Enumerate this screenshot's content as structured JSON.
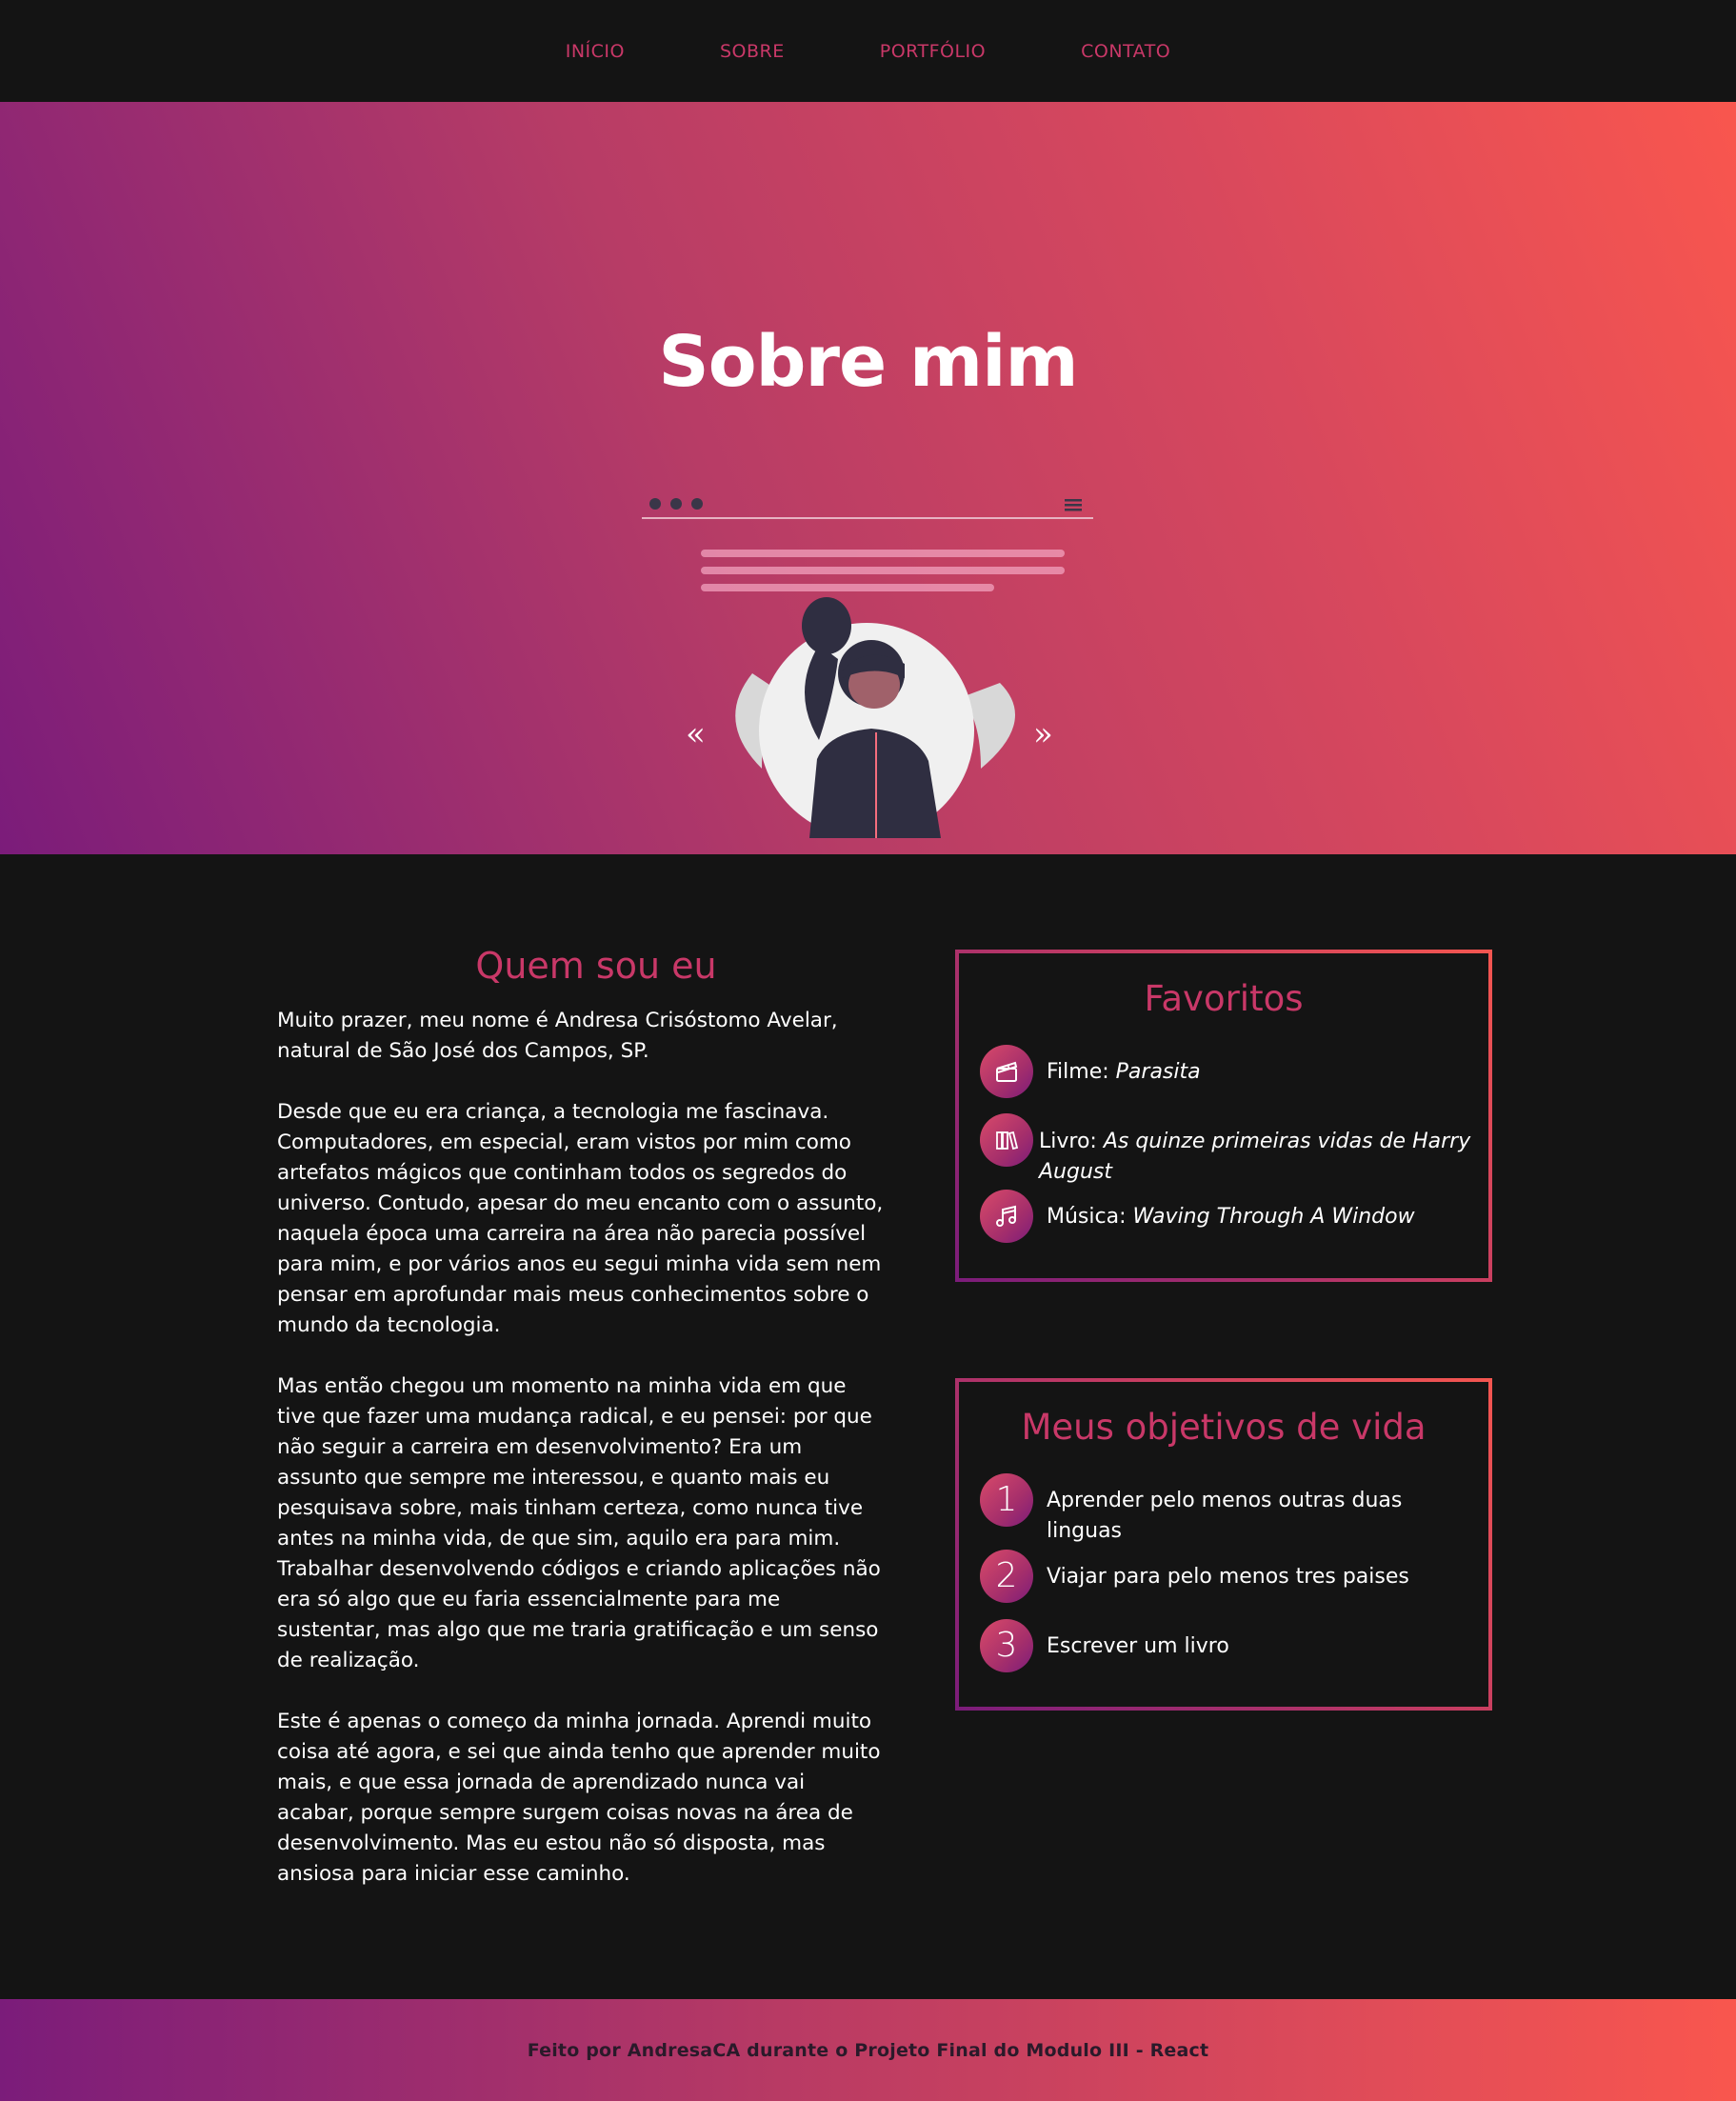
{
  "nav": {
    "items": [
      "INÍCIO",
      "SOBRE",
      "PORTFÓLIO",
      "CONTATO"
    ]
  },
  "hero": {
    "title": "Sobre mim"
  },
  "about": {
    "heading": "Quem sou eu",
    "paragraphs": [
      "Muito prazer, meu nome é Andresa Crisóstomo Avelar, natural de São José dos Campos, SP.",
      "Desde que eu era criança, a tecnologia me fascinava. Computadores, em especial, eram vistos por mim como artefatos mágicos que continham todos os segredos do universo. Contudo, apesar do meu encanto com o assunto, naquela época uma carreira na área não parecia possível para mim, e por vários anos eu segui minha vida sem nem pensar em aprofundar mais meus conhecimentos sobre o mundo da tecnologia.",
      "Mas então chegou um momento na minha vida em que tive que fazer uma mudança radical, e eu pensei: por que não seguir a carreira em desenvolvimento? Era um assunto que sempre me interessou, e quanto mais eu pesquisava sobre, mais tinham certeza, como nunca tive antes na minha vida, de que sim, aquilo era para mim. Trabalhar desenvolvendo códigos e criando aplicações não era só algo que eu faria essencialmente para me sustentar, mas algo que me traria gratificação e um senso de realização.",
      "Este é apenas o começo da minha jornada. Aprendi muito coisa até agora, e sei que ainda tenho que aprender muito mais, e que essa jornada de aprendizado nunca vai acabar, porque sempre surgem coisas novas na área de desenvolvimento. Mas eu estou não só disposta, mas ansiosa para iniciar esse caminho."
    ]
  },
  "favorites": {
    "heading": "Favoritos",
    "items": [
      {
        "icon": "film-clapperboard-icon",
        "label": "Filme:",
        "value": "Parasita"
      },
      {
        "icon": "books-icon",
        "label": "Livro:",
        "value": "As quinze primeiras vidas de Harry August"
      },
      {
        "icon": "music-note-icon",
        "label": "Música:",
        "value": "Waving Through A Window"
      }
    ]
  },
  "goals": {
    "heading": "Meus objetivos de vida",
    "items": [
      {
        "num": "1",
        "text": "Aprender pelo menos outras duas linguas"
      },
      {
        "num": "2",
        "text": "Viajar para pelo menos tres paises"
      },
      {
        "num": "3",
        "text": "Escrever um livro"
      }
    ]
  },
  "footer": {
    "text": "Feito por AndresaCA durante o Projeto Final do Modulo III - React"
  },
  "colors": {
    "accent": "#c93868",
    "background": "#141414",
    "gradient_start": "#7b1c7a",
    "gradient_end": "#f9564e"
  }
}
